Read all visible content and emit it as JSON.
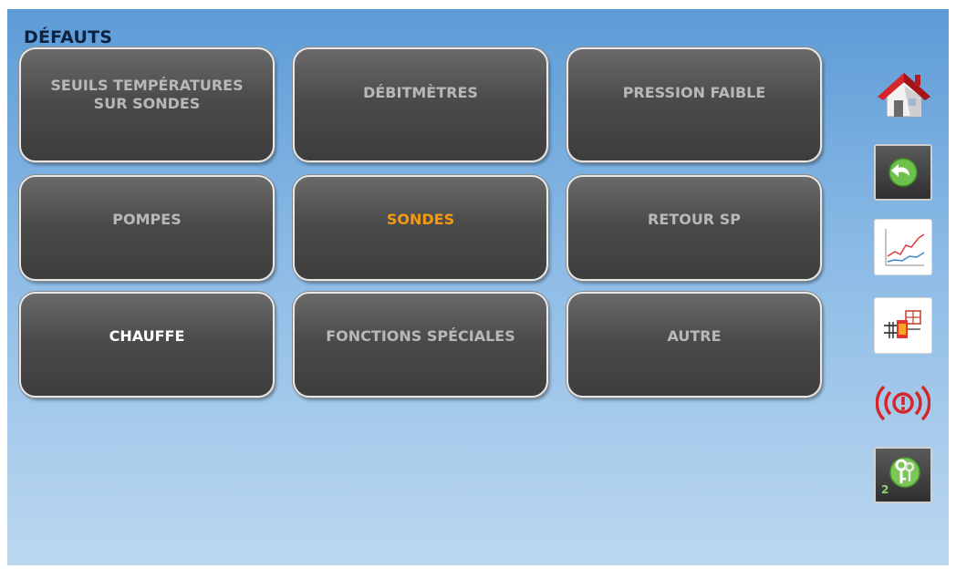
{
  "page": {
    "title": "DÉFAUTS"
  },
  "buttons": [
    {
      "label": "SEUILS TEMPÉRATURES SUR SONDES",
      "state": "normal"
    },
    {
      "label": "DÉBITMÈTRES",
      "state": "normal"
    },
    {
      "label": "PRESSION FAIBLE",
      "state": "normal"
    },
    {
      "label": "POMPES",
      "state": "normal"
    },
    {
      "label": "SONDES",
      "state": "active"
    },
    {
      "label": "RETOUR SP",
      "state": "normal"
    },
    {
      "label": "CHAUFFE",
      "state": "highlighted"
    },
    {
      "label": "FONCTIONS SPÉCIALES",
      "state": "normal"
    },
    {
      "label": "AUTRE",
      "state": "normal"
    }
  ],
  "sidebar": {
    "icons": [
      "home-icon",
      "back-icon",
      "trend-chart-icon",
      "schematic-icon",
      "alarm-icon",
      "access-keys-icon"
    ],
    "access_level": "2"
  },
  "colors": {
    "active_text": "#f39a10",
    "button_text": "#b8b8b8",
    "highlight_text": "#ffffff",
    "alarm": "#d6262a",
    "home_roof": "#d6262a"
  }
}
